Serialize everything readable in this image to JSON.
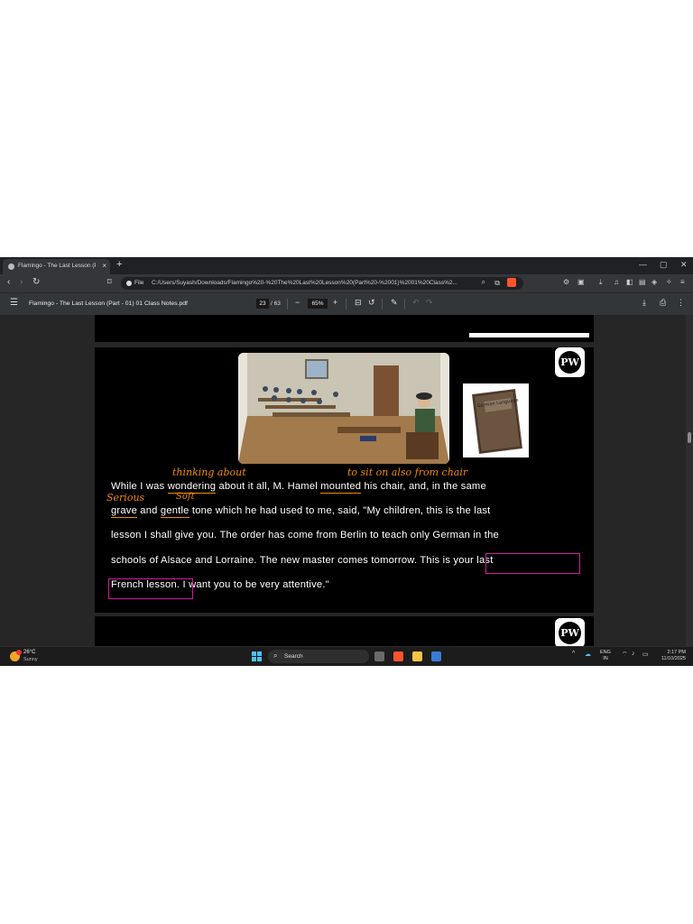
{
  "browser": {
    "tab_title": "Flamingo - The Last Lesson (Part",
    "tab_close": "×",
    "new_tab": "+",
    "window_controls": [
      "—",
      "▢",
      "✕"
    ],
    "nav": {
      "back": "‹",
      "forward": "›",
      "reload": "↻"
    },
    "address": {
      "scheme_label": "File",
      "url": "C:/Users/Suyash/Downloads/Flamingo%20-%20The%20Last%20Lesson%20(Part%20-%2001)%2001%20Class%2..."
    }
  },
  "pdf_viewer": {
    "menu_icon": "☰",
    "file_title": "Flamingo - The Last Lesson (Part - 01) 01 Class Notes.pdf",
    "current_page": "23",
    "total_pages": "/ 63",
    "zoom_minus": "−",
    "zoom_value": "65%",
    "zoom_plus": "+"
  },
  "document": {
    "logo_text": "PW",
    "book_title": "German Language",
    "paragraph_lines": [
      [
        "While I was ",
        "wondering",
        " about it all, M. Hamel ",
        "mounted",
        " his chair, and, in the same"
      ],
      [
        "grave",
        " and ",
        "gentle",
        " tone which he had used to me, said, \"My children, this is the last"
      ],
      [
        "lesson I shall give you. The order has come from Berlin to teach only German in the"
      ],
      [
        "schools of Alsace and Lorraine. The new master comes tomorrow. ",
        "This is your last"
      ],
      [
        "French lesson.",
        " I want you to be very attentive.\""
      ]
    ],
    "annotations": {
      "wondering_note": "thinking about",
      "mounted_note": "to sit on also from chair",
      "grave_note": "Serious",
      "gentle_note": "Soft"
    }
  },
  "taskbar": {
    "weather_temp": "26°C",
    "weather_condition": "Sunny",
    "search_placeholder": "Search",
    "language_line1": "ENG",
    "language_line2": "IN",
    "time": "2:17 PM",
    "date": "11/10/2025"
  },
  "colors": {
    "annotation_orange": "#f08a00",
    "highlight_magenta": "#d21a9c",
    "windows_blue": "#4cc2ff"
  }
}
